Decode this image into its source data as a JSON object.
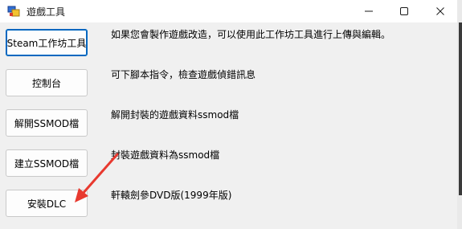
{
  "window": {
    "title": "遊戲工具",
    "controls": {
      "minimize_icon": "minimize-icon",
      "maximize_icon": "maximize-icon",
      "close_icon": "close-icon"
    }
  },
  "tools": [
    {
      "button_label": "Steam工作坊工具",
      "description": "如果您會製作遊戲改造，可以使用此工作坊工具進行上傳與編輯。",
      "focused": true
    },
    {
      "button_label": "控制台",
      "description": "可下腳本指令，檢查遊戲偵錯訊息",
      "focused": false
    },
    {
      "button_label": "解開SSMOD檔",
      "description": "解開封裝的遊戲資料ssmod檔",
      "focused": false
    },
    {
      "button_label": "建立SSMOD檔",
      "description": "封裝遊戲資料為ssmod檔",
      "focused": false
    },
    {
      "button_label": "安裝DLC",
      "description": "軒轅劍參DVD版(1999年版)",
      "focused": false
    }
  ],
  "annotation": {
    "type": "arrow",
    "color": "#e8392f",
    "target": "安裝DLC"
  },
  "colors": {
    "accent": "#0067c0",
    "window_bg": "#f0f0f0",
    "titlebar_bg": "#ffffff"
  }
}
